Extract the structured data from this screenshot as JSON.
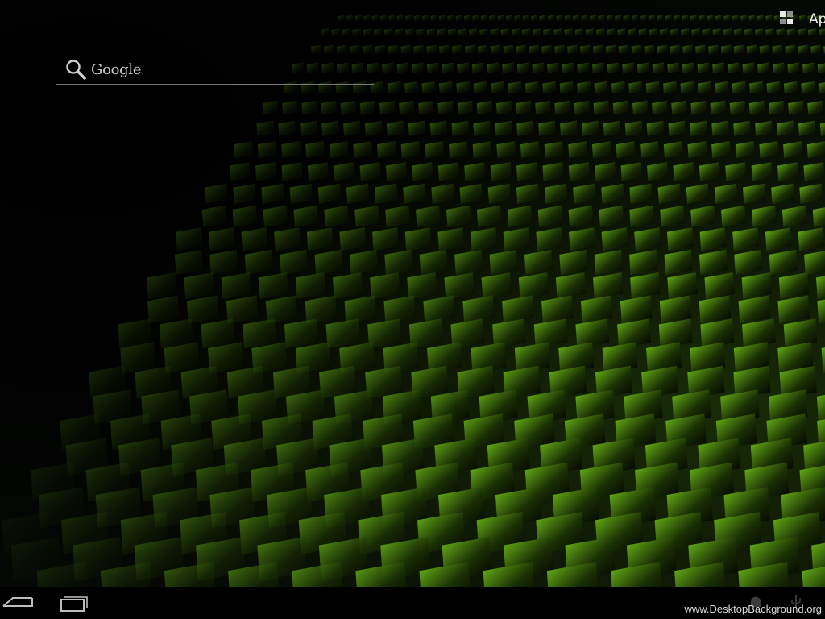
{
  "wallpaper": {
    "theme": "green-carbon-weave",
    "accent_color": "#6fbf1a",
    "dark_color": "#1b3004"
  },
  "search": {
    "placeholder": "Google",
    "icon": "search-icon"
  },
  "apps": {
    "label": "Apps",
    "icon": "apps-grid-icon"
  },
  "nav": {
    "back_icon": "back-arrow-icon",
    "recent_icon": "recent-apps-icon"
  },
  "status": {
    "icons": [
      "android-icon",
      "usb-icon"
    ]
  },
  "watermark": {
    "text": "www.DesktopBackground.org"
  }
}
